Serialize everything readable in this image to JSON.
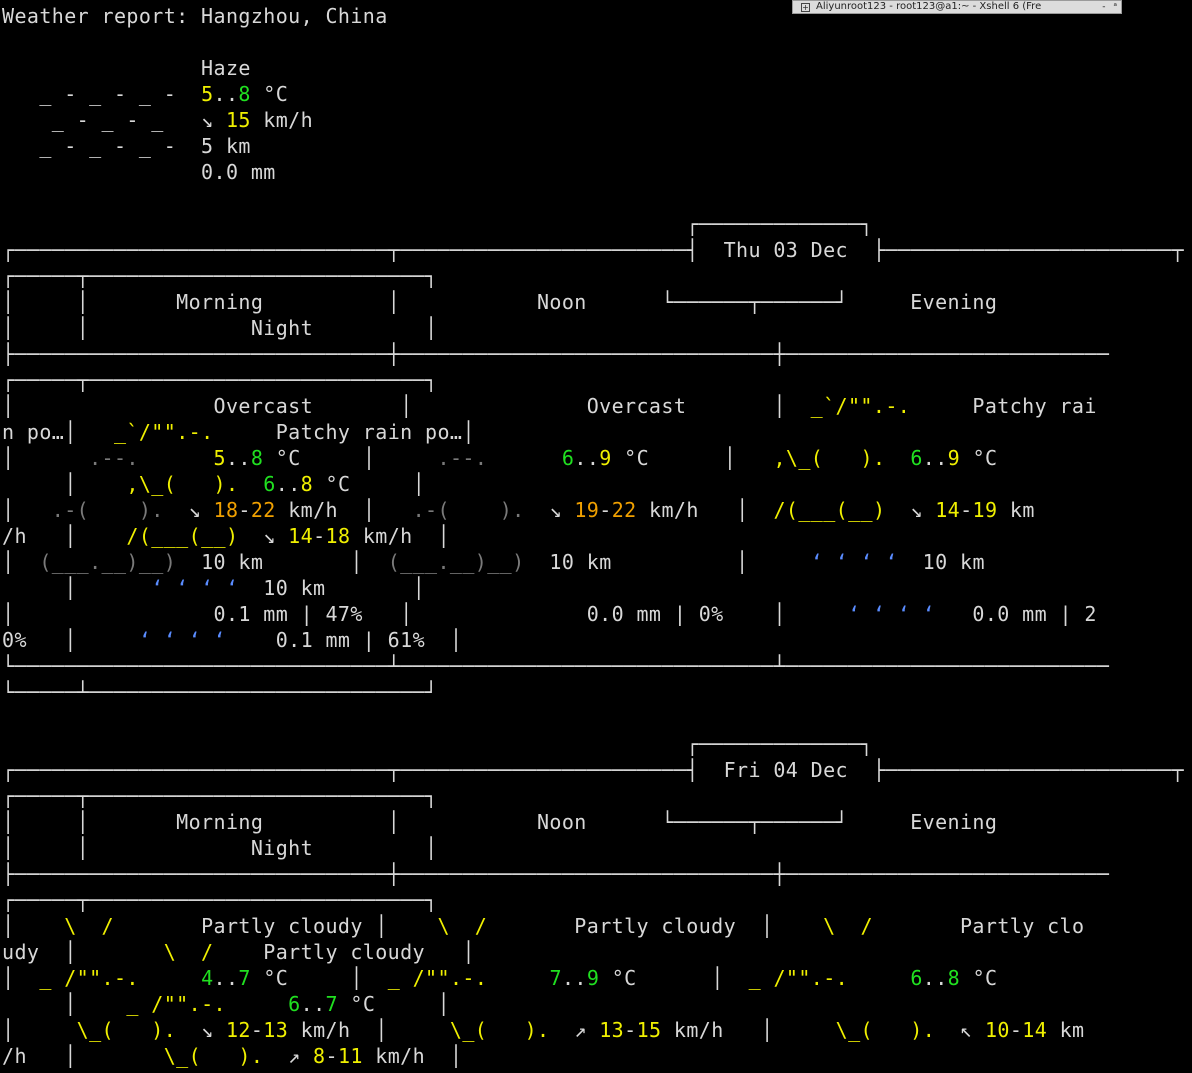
{
  "window": {
    "title": "Aliyunroot123 - root123@a1:~ - Xshell 6 (Fre",
    "pin_label": "+",
    "minimize_label": "-",
    "restore_label": "ᵃ"
  },
  "colors": {
    "background": "#000000",
    "default_text": "#d8d8d8",
    "green": "#20e020",
    "yellow": "#f0f000",
    "orange": "#f0a000",
    "blue_rain": "#5a8cff",
    "dim_cloud": "#7a7a7a"
  },
  "terminal": {
    "lines": [
      [
        {
          "t": "Weather report: Hangzhou, China",
          "c": "w"
        }
      ],
      [],
      [
        {
          "t": "                Haze",
          "c": "w"
        }
      ],
      [
        {
          "t": "   _ - _ - _ -  ",
          "c": "w"
        },
        {
          "t": "5",
          "c": "y"
        },
        {
          "t": "..",
          "c": "w"
        },
        {
          "t": "8",
          "c": "g"
        },
        {
          "t": " °C",
          "c": "w"
        }
      ],
      [
        {
          "t": "    _ - _ - _   ",
          "c": "w"
        },
        {
          "t": "↘ ",
          "c": "w"
        },
        {
          "t": "15",
          "c": "y"
        },
        {
          "t": " km/h",
          "c": "w"
        }
      ],
      [
        {
          "t": "   _ - _ - _ -  5 km",
          "c": "w"
        }
      ],
      [
        {
          "t": "                0.0 mm",
          "c": "w"
        }
      ],
      [],
      [
        {
          "t": "                                                       ┌─────────────┐",
          "c": "w"
        }
      ],
      [
        {
          "t": "┌──────────────────────────────┬───────────────────────┤  Thu 03 Dec  ├───────────────────────┬",
          "c": "w"
        }
      ],
      [
        {
          "t": "┌─────┬───────────────────────────┐",
          "c": "w"
        }
      ],
      [
        {
          "t": "│     │       Morning          │",
          "c": "w"
        },
        {
          "t": "           Noon      └──────┬──────┘     Evening           ",
          "c": "w"
        }
      ],
      [
        {
          "t": "│     │             Night         │",
          "c": "w"
        }
      ],
      [
        {
          "t": "├──────────────────────────────┼──────────────────────────────┼──────────────────────────",
          "c": "w"
        }
      ],
      [
        {
          "t": "┌─────┬───────────────────────────┐",
          "c": "w"
        }
      ],
      [
        {
          "t": "│                Overcast       │              Overcast       │  ",
          "c": "w"
        },
        {
          "t": "_`/\"\".-.",
          "c": "y"
        },
        {
          "t": "     Patchy rai",
          "c": "w"
        }
      ],
      [
        {
          "t": "n po…│   ",
          "c": "w"
        },
        {
          "t": "_`/\"\".-.",
          "c": "y"
        },
        {
          "t": "     Patchy rain po…│",
          "c": "w"
        }
      ],
      [
        {
          "t": "│      ",
          "c": "w"
        },
        {
          "t": ".--.",
          "c": "d"
        },
        {
          "t": "      ",
          "c": "w"
        },
        {
          "t": "5",
          "c": "y"
        },
        {
          "t": "..",
          "c": "w"
        },
        {
          "t": "8",
          "c": "g"
        },
        {
          "t": " °C     │     ",
          "c": "w"
        },
        {
          "t": ".--.",
          "c": "d"
        },
        {
          "t": "      ",
          "c": "w"
        },
        {
          "t": "6",
          "c": "g"
        },
        {
          "t": "..",
          "c": "w"
        },
        {
          "t": "9",
          "c": "y"
        },
        {
          "t": " °C      │   ",
          "c": "w"
        },
        {
          "t": ",\\_(   ).",
          "c": "y"
        },
        {
          "t": "  ",
          "c": "w"
        },
        {
          "t": "6",
          "c": "g"
        },
        {
          "t": "..",
          "c": "w"
        },
        {
          "t": "9",
          "c": "y"
        },
        {
          "t": " °C",
          "c": "w"
        }
      ],
      [
        {
          "t": "     │    ",
          "c": "w"
        },
        {
          "t": ",\\_(   ).",
          "c": "y"
        },
        {
          "t": "  ",
          "c": "w"
        },
        {
          "t": "6",
          "c": "g"
        },
        {
          "t": "..",
          "c": "w"
        },
        {
          "t": "8",
          "c": "y"
        },
        {
          "t": " °C     │",
          "c": "w"
        }
      ],
      [
        {
          "t": "│   ",
          "c": "w"
        },
        {
          "t": ".-(    ).",
          "c": "d"
        },
        {
          "t": "  ↘ ",
          "c": "w"
        },
        {
          "t": "18",
          "c": "o"
        },
        {
          "t": "-",
          "c": "w"
        },
        {
          "t": "22",
          "c": "o"
        },
        {
          "t": " km/h  │   ",
          "c": "w"
        },
        {
          "t": ".-(    ).",
          "c": "d"
        },
        {
          "t": "  ↘ ",
          "c": "w"
        },
        {
          "t": "19",
          "c": "o"
        },
        {
          "t": "-",
          "c": "w"
        },
        {
          "t": "22",
          "c": "o"
        },
        {
          "t": " km/h   │  ",
          "c": "w"
        },
        {
          "t": "/(___(__)",
          "c": "y"
        },
        {
          "t": "  ↘ ",
          "c": "w"
        },
        {
          "t": "14",
          "c": "y"
        },
        {
          "t": "-",
          "c": "w"
        },
        {
          "t": "19",
          "c": "y"
        },
        {
          "t": " km",
          "c": "w"
        }
      ],
      [
        {
          "t": "/h   │    ",
          "c": "w"
        },
        {
          "t": "/(___(__)",
          "c": "y"
        },
        {
          "t": "  ↘ ",
          "c": "w"
        },
        {
          "t": "14",
          "c": "y"
        },
        {
          "t": "-",
          "c": "w"
        },
        {
          "t": "18",
          "c": "y"
        },
        {
          "t": " km/h  │",
          "c": "w"
        }
      ],
      [
        {
          "t": "│  ",
          "c": "w"
        },
        {
          "t": "(___.__)__)",
          "c": "d"
        },
        {
          "t": "  10 km       │  ",
          "c": "w"
        },
        {
          "t": "(___.__)__)",
          "c": "d"
        },
        {
          "t": "  10 km          │     ",
          "c": "w"
        },
        {
          "t": "‘ ‘ ‘ ‘",
          "c": "b"
        },
        {
          "t": "  10 km",
          "c": "w"
        }
      ],
      [
        {
          "t": "     │      ",
          "c": "w"
        },
        {
          "t": "‘ ‘ ‘ ‘",
          "c": "b"
        },
        {
          "t": "  10 km       │",
          "c": "w"
        }
      ],
      [
        {
          "t": "│                0.1 mm | 47%   │              0.0 mm | 0%    │     ",
          "c": "w"
        },
        {
          "t": "‘ ‘ ‘ ‘",
          "c": "b"
        },
        {
          "t": "   0.0 mm | 2",
          "c": "w"
        }
      ],
      [
        {
          "t": "0%   │     ",
          "c": "w"
        },
        {
          "t": "‘ ‘ ‘ ‘",
          "c": "b"
        },
        {
          "t": "    0.1 mm | 61%  │",
          "c": "w"
        }
      ],
      [
        {
          "t": "└──────────────────────────────┴──────────────────────────────┴──────────────────────────",
          "c": "w"
        }
      ],
      [
        {
          "t": "└─────┴───────────────────────────┘",
          "c": "w"
        }
      ],
      [],
      [
        {
          "t": "                                                       ┌─────────────┐",
          "c": "w"
        }
      ],
      [
        {
          "t": "┌──────────────────────────────┬───────────────────────┤  Fri 04 Dec  ├───────────────────────┬",
          "c": "w"
        }
      ],
      [
        {
          "t": "┌─────┬───────────────────────────┐",
          "c": "w"
        }
      ],
      [
        {
          "t": "│     │       Morning          │",
          "c": "w"
        },
        {
          "t": "           Noon      └──────┬──────┘     Evening           ",
          "c": "w"
        }
      ],
      [
        {
          "t": "│     │             Night         │",
          "c": "w"
        }
      ],
      [
        {
          "t": "├──────────────────────────────┼──────────────────────────────┼──────────────────────────",
          "c": "w"
        }
      ],
      [
        {
          "t": "┌─────┬───────────────────────────┐",
          "c": "w"
        }
      ],
      [
        {
          "t": "│    ",
          "c": "w"
        },
        {
          "t": "\\  /",
          "c": "y"
        },
        {
          "t": "       Partly cloudy │    ",
          "c": "w"
        },
        {
          "t": "\\  /",
          "c": "y"
        },
        {
          "t": "       Partly cloudy  │    ",
          "c": "w"
        },
        {
          "t": "\\  /",
          "c": "y"
        },
        {
          "t": "       Partly clo",
          "c": "w"
        }
      ],
      [
        {
          "t": "udy  │       ",
          "c": "w"
        },
        {
          "t": "\\  /",
          "c": "y"
        },
        {
          "t": "    Partly cloudy   │",
          "c": "w"
        }
      ],
      [
        {
          "t": "│  ",
          "c": "w"
        },
        {
          "t": "_ /\"\".-.",
          "c": "y"
        },
        {
          "t": "     ",
          "c": "w"
        },
        {
          "t": "4",
          "c": "g"
        },
        {
          "t": "..",
          "c": "w"
        },
        {
          "t": "7",
          "c": "g"
        },
        {
          "t": " °C     │  ",
          "c": "w"
        },
        {
          "t": "_ /\"\".-.",
          "c": "y"
        },
        {
          "t": "     ",
          "c": "w"
        },
        {
          "t": "7",
          "c": "g"
        },
        {
          "t": "..",
          "c": "w"
        },
        {
          "t": "9",
          "c": "g"
        },
        {
          "t": " °C      │  ",
          "c": "w"
        },
        {
          "t": "_ /\"\".-.",
          "c": "y"
        },
        {
          "t": "     ",
          "c": "w"
        },
        {
          "t": "6",
          "c": "g"
        },
        {
          "t": "..",
          "c": "w"
        },
        {
          "t": "8",
          "c": "g"
        },
        {
          "t": " °C",
          "c": "w"
        }
      ],
      [
        {
          "t": "     │    ",
          "c": "w"
        },
        {
          "t": "_ /\"\".-.",
          "c": "y"
        },
        {
          "t": "     ",
          "c": "w"
        },
        {
          "t": "6",
          "c": "g"
        },
        {
          "t": "..",
          "c": "w"
        },
        {
          "t": "7",
          "c": "g"
        },
        {
          "t": " °C     │",
          "c": "w"
        }
      ],
      [
        {
          "t": "│     ",
          "c": "w"
        },
        {
          "t": "\\_(   ).",
          "c": "y"
        },
        {
          "t": "  ↘ ",
          "c": "w"
        },
        {
          "t": "12",
          "c": "y"
        },
        {
          "t": "-",
          "c": "w"
        },
        {
          "t": "13",
          "c": "y"
        },
        {
          "t": " km/h  │     ",
          "c": "w"
        },
        {
          "t": "\\_(   ).",
          "c": "y"
        },
        {
          "t": "  ↗ ",
          "c": "w"
        },
        {
          "t": "13",
          "c": "y"
        },
        {
          "t": "-",
          "c": "w"
        },
        {
          "t": "15",
          "c": "y"
        },
        {
          "t": " km/h   │     ",
          "c": "w"
        },
        {
          "t": "\\_(   ).",
          "c": "y"
        },
        {
          "t": "  ↖ ",
          "c": "w"
        },
        {
          "t": "10",
          "c": "y"
        },
        {
          "t": "-",
          "c": "w"
        },
        {
          "t": "14",
          "c": "y"
        },
        {
          "t": " km",
          "c": "w"
        }
      ],
      [
        {
          "t": "/h   │       ",
          "c": "w"
        },
        {
          "t": "\\_(   ).",
          "c": "y"
        },
        {
          "t": "  ↗ ",
          "c": "w"
        },
        {
          "t": "8",
          "c": "y"
        },
        {
          "t": "-",
          "c": "w"
        },
        {
          "t": "11",
          "c": "y"
        },
        {
          "t": " km/h  │",
          "c": "w"
        }
      ]
    ]
  }
}
